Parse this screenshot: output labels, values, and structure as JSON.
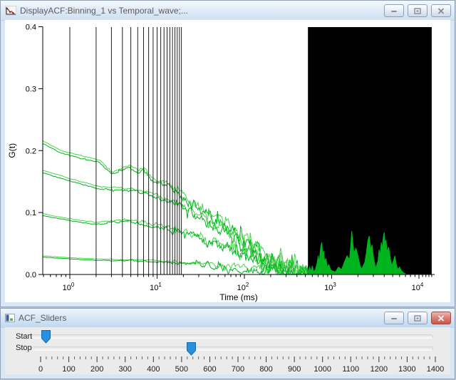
{
  "main_window": {
    "title": "DisplayACF:Binning_1 vs Temporal_wave;...",
    "icon": "graph-icon",
    "buttons": {
      "minimize": "minimize",
      "maximize": "maximize",
      "close": "close"
    }
  },
  "sliders_window": {
    "title": "ACF_Sliders",
    "icon": "panel-icon",
    "buttons": {
      "minimize": "minimize",
      "maximize": "maximize",
      "close": "close"
    },
    "rows": [
      {
        "label": "Start",
        "value": 20
      },
      {
        "label": "Stop",
        "value": 535
      }
    ],
    "axis": {
      "min": 0,
      "max": 1400,
      "major_step": 100,
      "minor_step": 20
    },
    "thumb_color": "#2a8fdc",
    "thumb_border": "#1668ad"
  },
  "chart_data": {
    "type": "line",
    "title": "",
    "xlabel": "Time (ms)",
    "ylabel": "G(t)",
    "xscale": "log",
    "xlim": [
      0.49,
      15000
    ],
    "ylim": [
      0.0,
      0.4
    ],
    "x_major_ticks": [
      1,
      10,
      100,
      1000,
      10000
    ],
    "x_major_labels": [
      [
        "10",
        "0"
      ],
      [
        "10",
        "1"
      ],
      [
        "10",
        "2"
      ],
      [
        "10",
        "3"
      ],
      [
        "10",
        "4"
      ]
    ],
    "y_major_ticks": [
      0.0,
      0.1,
      0.2,
      0.3,
      0.4
    ],
    "y_major_labels": [
      "0.0",
      "0.1",
      "0.2",
      "0.3",
      "0.4"
    ],
    "colors": {
      "dark_green": "#00B41E",
      "light_green": "#4FD24F",
      "axis": "#000000",
      "marker_line": "#1f1f1f",
      "mask": "#000000"
    },
    "bands": [
      {
        "envelope": [
          [
            0.5,
            0.215
          ],
          [
            0.8,
            0.2
          ],
          [
            1.5,
            0.19
          ],
          [
            2.2,
            0.185
          ],
          [
            3,
            0.166
          ],
          [
            4,
            0.172
          ],
          [
            4.8,
            0.177
          ],
          [
            6,
            0.168
          ],
          [
            7,
            0.173
          ],
          [
            8.5,
            0.158
          ],
          [
            10,
            0.152
          ],
          [
            13,
            0.148
          ],
          [
            17,
            0.136
          ],
          [
            22,
            0.124
          ],
          [
            30,
            0.11
          ],
          [
            45,
            0.095
          ],
          [
            70,
            0.075
          ],
          [
            100,
            0.058
          ],
          [
            150,
            0.042
          ],
          [
            220,
            0.028
          ],
          [
            320,
            0.016
          ],
          [
            450,
            0.01
          ],
          [
            535,
            0.008
          ]
        ]
      },
      {
        "envelope": [
          [
            0.5,
            0.168
          ],
          [
            1,
            0.155
          ],
          [
            2,
            0.143
          ],
          [
            3.5,
            0.14
          ],
          [
            5,
            0.139
          ],
          [
            7,
            0.136
          ],
          [
            10,
            0.128
          ],
          [
            14,
            0.12
          ],
          [
            20,
            0.11
          ],
          [
            30,
            0.096
          ],
          [
            50,
            0.078
          ],
          [
            80,
            0.06
          ],
          [
            120,
            0.045
          ],
          [
            180,
            0.03
          ],
          [
            280,
            0.018
          ],
          [
            400,
            0.01
          ],
          [
            535,
            0.007
          ]
        ]
      },
      {
        "envelope": [
          [
            0.5,
            0.098
          ],
          [
            1,
            0.09
          ],
          [
            2,
            0.084
          ],
          [
            3,
            0.087
          ],
          [
            4.5,
            0.089
          ],
          [
            7,
            0.084
          ],
          [
            10,
            0.08
          ],
          [
            15,
            0.075
          ],
          [
            22,
            0.068
          ],
          [
            35,
            0.058
          ],
          [
            60,
            0.045
          ],
          [
            100,
            0.032
          ],
          [
            160,
            0.02
          ],
          [
            250,
            0.012
          ],
          [
            400,
            0.007
          ],
          [
            535,
            0.005
          ]
        ]
      },
      {
        "envelope": [
          [
            0.5,
            0.03
          ],
          [
            1,
            0.027
          ],
          [
            2,
            0.025
          ],
          [
            4,
            0.024
          ],
          [
            8,
            0.023
          ],
          [
            15,
            0.021
          ],
          [
            30,
            0.018
          ],
          [
            60,
            0.014
          ],
          [
            120,
            0.01
          ],
          [
            250,
            0.007
          ],
          [
            535,
            0.005
          ]
        ]
      }
    ],
    "series": [
      {
        "band": 0,
        "color": "light_green",
        "seed": 11,
        "noise": 1.0,
        "offset": 0
      },
      {
        "band": 0,
        "color": "dark_green",
        "seed": 47,
        "noise": 1.15,
        "offset": -0.004
      },
      {
        "band": 1,
        "color": "light_green",
        "seed": 23,
        "noise": 0.95,
        "offset": 0
      },
      {
        "band": 1,
        "color": "dark_green",
        "seed": 71,
        "noise": 1.1,
        "offset": -0.004
      },
      {
        "band": 2,
        "color": "light_green",
        "seed": 35,
        "noise": 0.85,
        "offset": 0
      },
      {
        "band": 2,
        "color": "dark_green",
        "seed": 59,
        "noise": 1.0,
        "offset": -0.003
      },
      {
        "band": 3,
        "color": "light_green",
        "seed": 83,
        "noise": 0.45,
        "offset": 0
      },
      {
        "band": 3,
        "color": "dark_green",
        "seed": 97,
        "noise": 0.55,
        "offset": -0.002
      }
    ],
    "noise_profile": [
      [
        0.5,
        0.0008
      ],
      [
        2,
        0.0015
      ],
      [
        5,
        0.003
      ],
      [
        10,
        0.005
      ],
      [
        20,
        0.009
      ],
      [
        40,
        0.014
      ],
      [
        80,
        0.018
      ],
      [
        150,
        0.022
      ],
      [
        300,
        0.023
      ],
      [
        535,
        0.02
      ]
    ],
    "start_marker_lines": [
      1,
      2,
      3,
      4,
      5,
      6,
      7,
      8,
      9,
      10,
      11,
      12,
      13,
      14,
      15,
      16,
      17,
      18,
      19
    ],
    "masked_region": {
      "from": 535,
      "to": 14000
    },
    "spikes": [
      [
        540,
        0.006
      ],
      [
        560,
        0.012
      ],
      [
        580,
        0.005
      ],
      [
        600,
        0.014
      ],
      [
        620,
        0.004
      ],
      [
        650,
        0.008
      ],
      [
        680,
        0.018
      ],
      [
        700,
        0.03
      ],
      [
        720,
        0.02
      ],
      [
        750,
        0.045
      ],
      [
        770,
        0.052
      ],
      [
        790,
        0.03
      ],
      [
        810,
        0.038
      ],
      [
        830,
        0.02
      ],
      [
        860,
        0.026
      ],
      [
        890,
        0.012
      ],
      [
        930,
        0.016
      ],
      [
        970,
        0.008
      ],
      [
        1010,
        0.006
      ],
      [
        1100,
        0.004
      ],
      [
        1200,
        0.012
      ],
      [
        1300,
        0.008
      ],
      [
        1400,
        0.02
      ],
      [
        1500,
        0.03
      ],
      [
        1600,
        0.024
      ],
      [
        1650,
        0.044
      ],
      [
        1700,
        0.07
      ],
      [
        1750,
        0.05
      ],
      [
        1800,
        0.035
      ],
      [
        1900,
        0.042
      ],
      [
        2000,
        0.03
      ],
      [
        2100,
        0.016
      ],
      [
        2200,
        0.008
      ],
      [
        2400,
        0.02
      ],
      [
        2500,
        0.035
      ],
      [
        2600,
        0.055
      ],
      [
        2700,
        0.062
      ],
      [
        2800,
        0.04
      ],
      [
        2900,
        0.048
      ],
      [
        3000,
        0.03
      ],
      [
        3100,
        0.018
      ],
      [
        3200,
        0.01
      ],
      [
        3400,
        0.022
      ],
      [
        3500,
        0.04
      ],
      [
        3600,
        0.03
      ],
      [
        3700,
        0.052
      ],
      [
        3800,
        0.042
      ],
      [
        3900,
        0.06
      ],
      [
        4000,
        0.068
      ],
      [
        4100,
        0.048
      ],
      [
        4200,
        0.056
      ],
      [
        4300,
        0.036
      ],
      [
        4500,
        0.044
      ],
      [
        4700,
        0.026
      ],
      [
        4900,
        0.014
      ],
      [
        5100,
        0.022
      ],
      [
        5300,
        0.03
      ],
      [
        5500,
        0.016
      ],
      [
        5700,
        0.008
      ],
      [
        6000,
        0.012
      ],
      [
        6300,
        0.006
      ],
      [
        6600,
        0.003
      ],
      [
        7000,
        0.001
      ]
    ]
  }
}
